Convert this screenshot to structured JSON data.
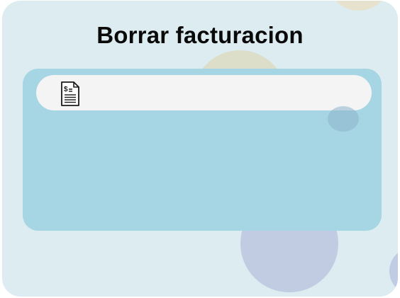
{
  "title": "Borrar facturacion",
  "search_bar": {
    "icon": "invoice-document-icon"
  },
  "colors": {
    "background": "#dcecf1",
    "panel": "#a6d5e3",
    "search_bar": "#f4f4f4",
    "title_text": "#0a0a0a"
  }
}
